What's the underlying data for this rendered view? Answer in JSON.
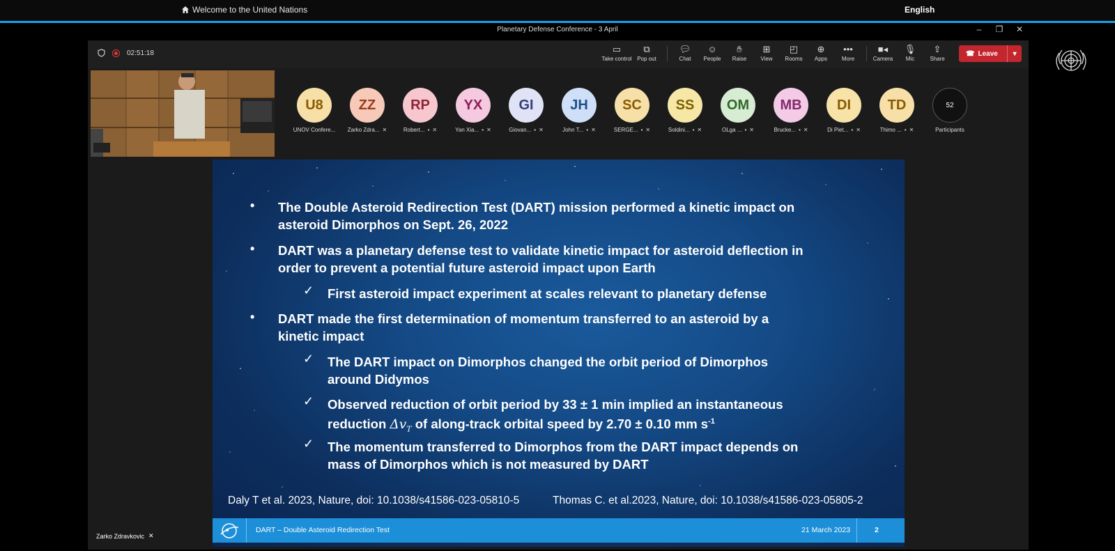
{
  "un_bar": {
    "home_label": "Welcome to the United Nations",
    "language": "English"
  },
  "window": {
    "title": "Planetary Defense Conference - 3 April"
  },
  "meeting": {
    "timer": "02:51:18",
    "toolbar": [
      {
        "icon": "take-control-icon",
        "label": "Take control"
      },
      {
        "icon": "pop-out-icon",
        "label": "Pop out"
      },
      {
        "icon": "chat-icon",
        "label": "Chat"
      },
      {
        "icon": "people-icon",
        "label": "People"
      },
      {
        "icon": "raise-hand-icon",
        "label": "Raise"
      },
      {
        "icon": "view-icon",
        "label": "View"
      },
      {
        "icon": "rooms-icon",
        "label": "Rooms"
      },
      {
        "icon": "apps-icon",
        "label": "Apps"
      },
      {
        "icon": "more-icon",
        "label": "More"
      },
      {
        "icon": "camera-icon",
        "label": "Camera"
      },
      {
        "icon": "mic-icon",
        "label": "Mic"
      },
      {
        "icon": "share-icon",
        "label": "Share"
      }
    ],
    "leave_label": "Leave",
    "participants": [
      {
        "initials": "U8",
        "name": "UNOV Confere...",
        "bg": "#f6e0a8",
        "fg": "#8a5a00"
      },
      {
        "initials": "ZZ",
        "name": "Zarko Zdra...",
        "bg": "#f7c9b9",
        "fg": "#9a3a1c"
      },
      {
        "initials": "RP",
        "name": "Robert...",
        "bg": "#f6c7cf",
        "fg": "#8f2236"
      },
      {
        "initials": "YX",
        "name": "Yan Xia...",
        "bg": "#f5c9df",
        "fg": "#8f1f58"
      },
      {
        "initials": "GI",
        "name": "Giovan...",
        "bg": "#dfe3f5",
        "fg": "#34407a"
      },
      {
        "initials": "JH",
        "name": "John T...",
        "bg": "#cfdff7",
        "fg": "#1e4f8f"
      },
      {
        "initials": "SC",
        "name": "SERGE...",
        "bg": "#f6e0a8",
        "fg": "#8a5a00"
      },
      {
        "initials": "SS",
        "name": "Soldini...",
        "bg": "#f6e7a6",
        "fg": "#7a6100"
      },
      {
        "initials": "OM",
        "name": "OLga ...",
        "bg": "#d7ecd2",
        "fg": "#2f6a2a"
      },
      {
        "initials": "MB",
        "name": "Brucke...",
        "bg": "#f3cbe6",
        "fg": "#852a6a"
      },
      {
        "initials": "DI",
        "name": "Di Piet...",
        "bg": "#f7e2a8",
        "fg": "#8a5a00"
      },
      {
        "initials": "TD",
        "name": "Thimo ...",
        "bg": "#f6e0a8",
        "fg": "#8a5a00"
      }
    ],
    "participants_count": "52",
    "participants_label": "Participants",
    "speaker_name": "Zarko Zdravkovic"
  },
  "slide": {
    "bullets": [
      {
        "line1": "The Double Asteroid Redirection Test (DART) mission performed a kinetic impact on",
        "line2": "asteroid Dimorphos on Sept. 26, 2022"
      },
      {
        "line1": "DART was a planetary defense test to validate kinetic impact for asteroid deflection in",
        "line2": "order to prevent a potential future asteroid impact upon Earth"
      },
      {
        "line1": "DART made the first determination of momentum transferred to an asteroid by a",
        "line2": "kinetic impact"
      }
    ],
    "checks": [
      {
        "line1": "First asteroid impact experiment at scales relevant to planetary defense",
        "line2": ""
      },
      {
        "line1": "The DART impact on Dimorphos changed the orbit period of Dimorphos",
        "line2": "around Didymos"
      },
      {
        "line1": "Observed reduction of orbit period by 33 ± 1 min implied an instantaneous",
        "line2a": "reduction ",
        "line2_math": "Δv",
        "line2_sub": "T",
        "line2b": " of along-track orbital speed by 2.70 ± 0.10 mm s",
        "line2_sup": "-1"
      },
      {
        "line1": "The momentum transferred to Dimorphos from the DART impact depends on",
        "line2": "mass of Dimorphos which is not measured by DART"
      }
    ],
    "ref1": "Daly T et al. 2023, Nature, doi: 10.1038/s41586-023-05810-5",
    "ref2": "Thomas C. et al.2023, Nature, doi: 10.1038/s41586-023-05805-2",
    "footer_title": "DART – Double Asteroid Redirection Test",
    "footer_date": "21 March 2023",
    "footer_page": "2"
  }
}
